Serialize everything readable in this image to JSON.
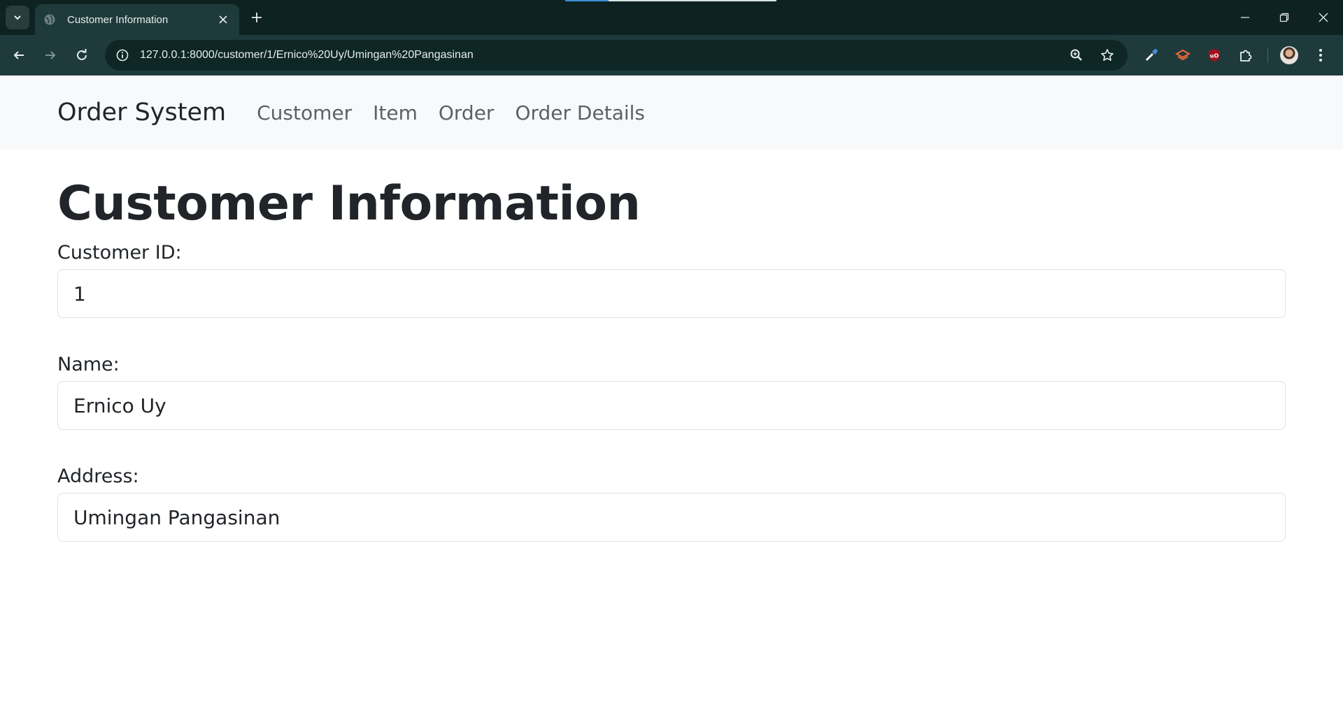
{
  "browser": {
    "tab_title": "Customer Information",
    "url": "127.0.0.1:8000/customer/1/Ernico%20Uy/Umingan%20Pangasinan",
    "colors": {
      "frame": "#0f2222",
      "toolbar": "#1f3a3a",
      "omnibox": "#0f2626"
    }
  },
  "navbar": {
    "brand": "Order System",
    "links": [
      "Customer",
      "Item",
      "Order",
      "Order Details"
    ]
  },
  "main": {
    "title": "Customer Information",
    "fields": [
      {
        "label": "Customer ID:",
        "value": "1"
      },
      {
        "label": "Name:",
        "value": "Ernico Uy"
      },
      {
        "label": "Address:",
        "value": "Umingan Pangasinan"
      }
    ]
  }
}
